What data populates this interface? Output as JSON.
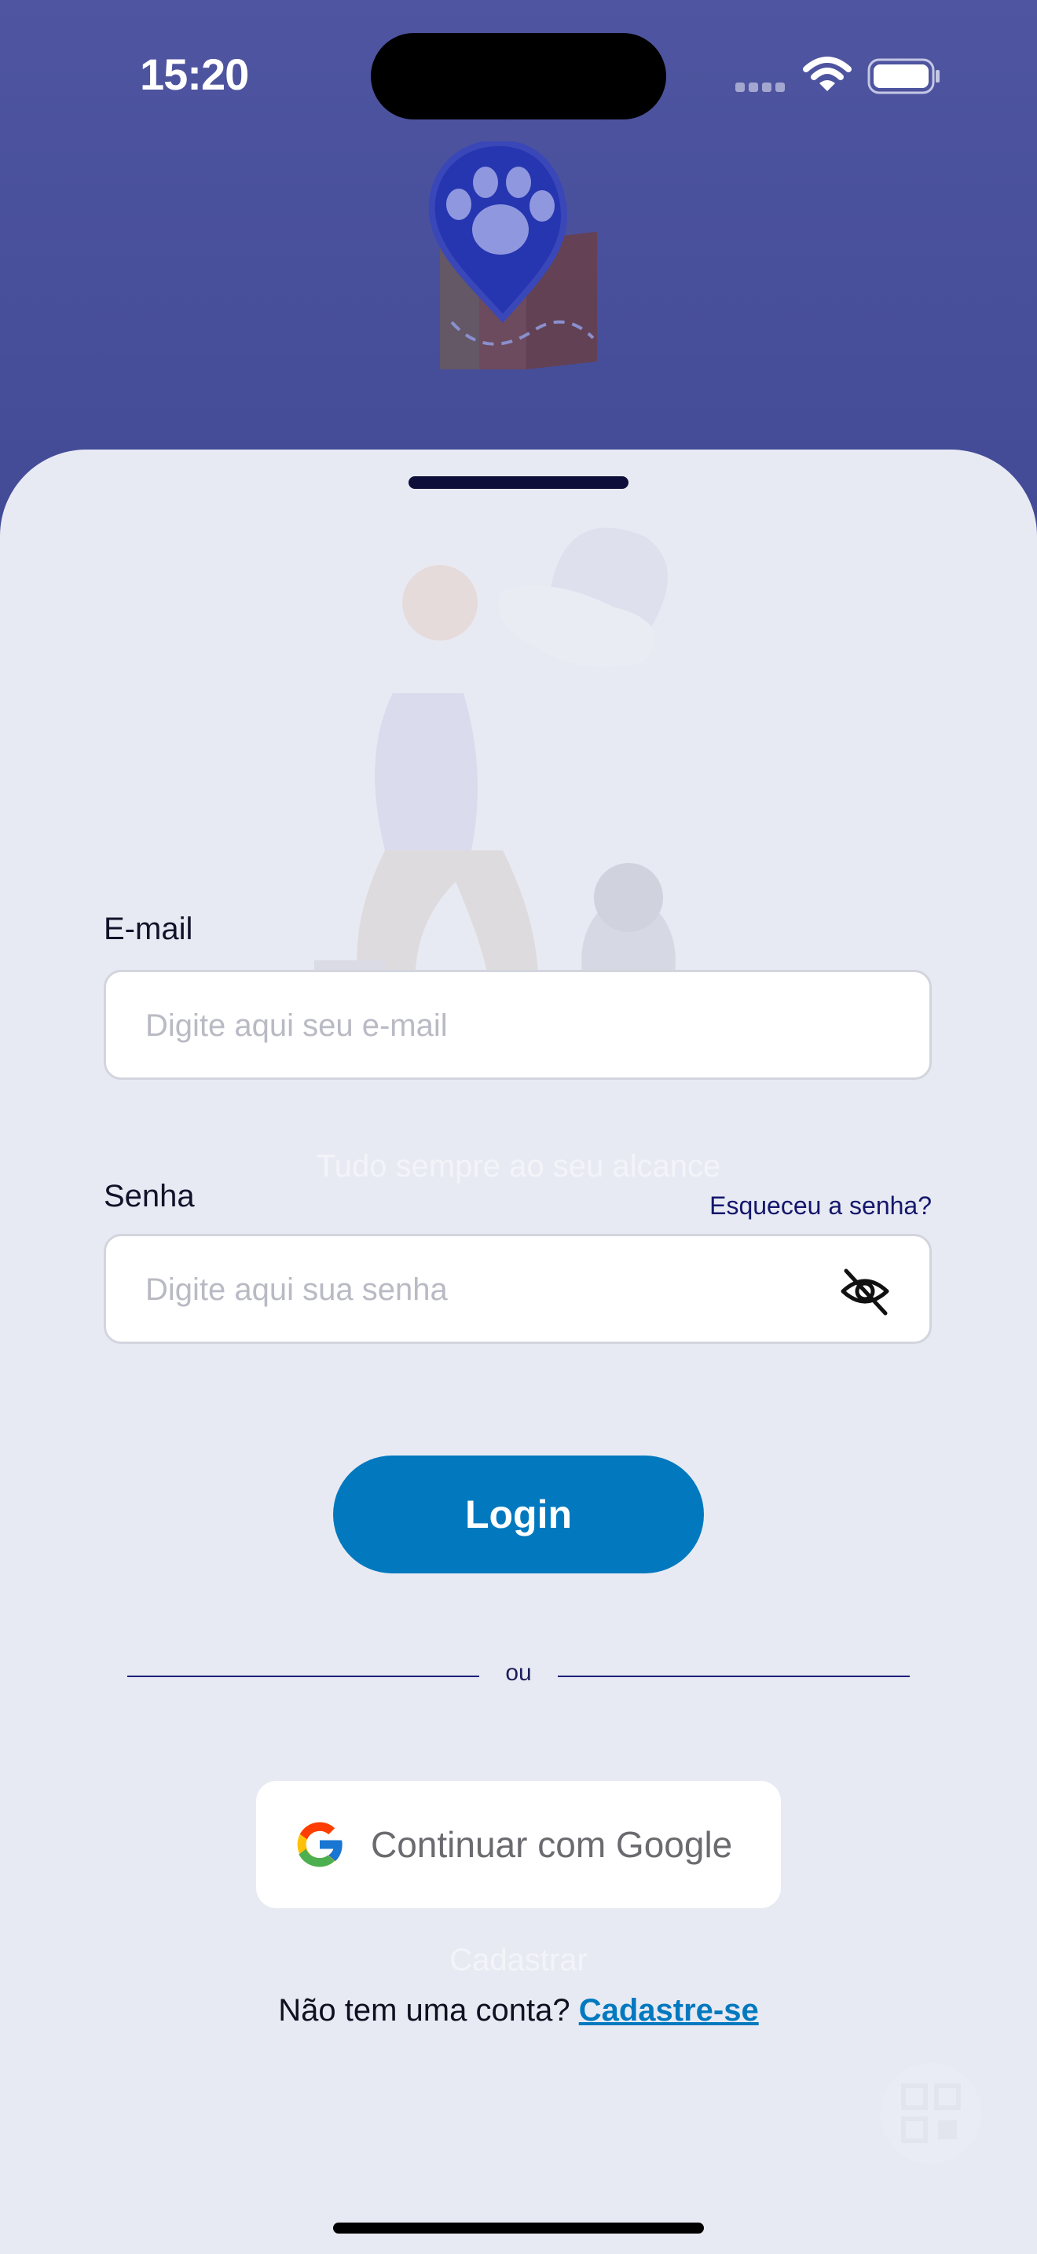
{
  "status_bar": {
    "time": "15:20",
    "signal_icon": "cellular-signal-icon",
    "wifi_icon": "wifi-icon",
    "battery_icon": "battery-icon"
  },
  "logo": {
    "icon": "paw-map-pin-logo",
    "colors": {
      "pin": "#2635b0",
      "map": "#7a4a4a"
    }
  },
  "background": {
    "ghost_tagline": "Tudo sempre ao seu alcance",
    "ghost_button": "Cadastrar"
  },
  "form": {
    "email": {
      "label": "E-mail",
      "placeholder": "Digite aqui seu e-mail",
      "value": ""
    },
    "password": {
      "label": "Senha",
      "placeholder": "Digite aqui sua senha",
      "value": "",
      "toggle_icon": "eye-off-icon"
    },
    "forgot_password": "Esqueceu a senha?",
    "login_button": "Login",
    "divider_text": "ou",
    "google_button": "Continuar com Google",
    "signup_prompt": "Não tem uma conta?",
    "signup_link": "Cadastre-se"
  },
  "colors": {
    "primary": "#0279bf",
    "header": "#4a50a0",
    "sheet": "#e8eaf3",
    "link_dark": "#14176b"
  }
}
